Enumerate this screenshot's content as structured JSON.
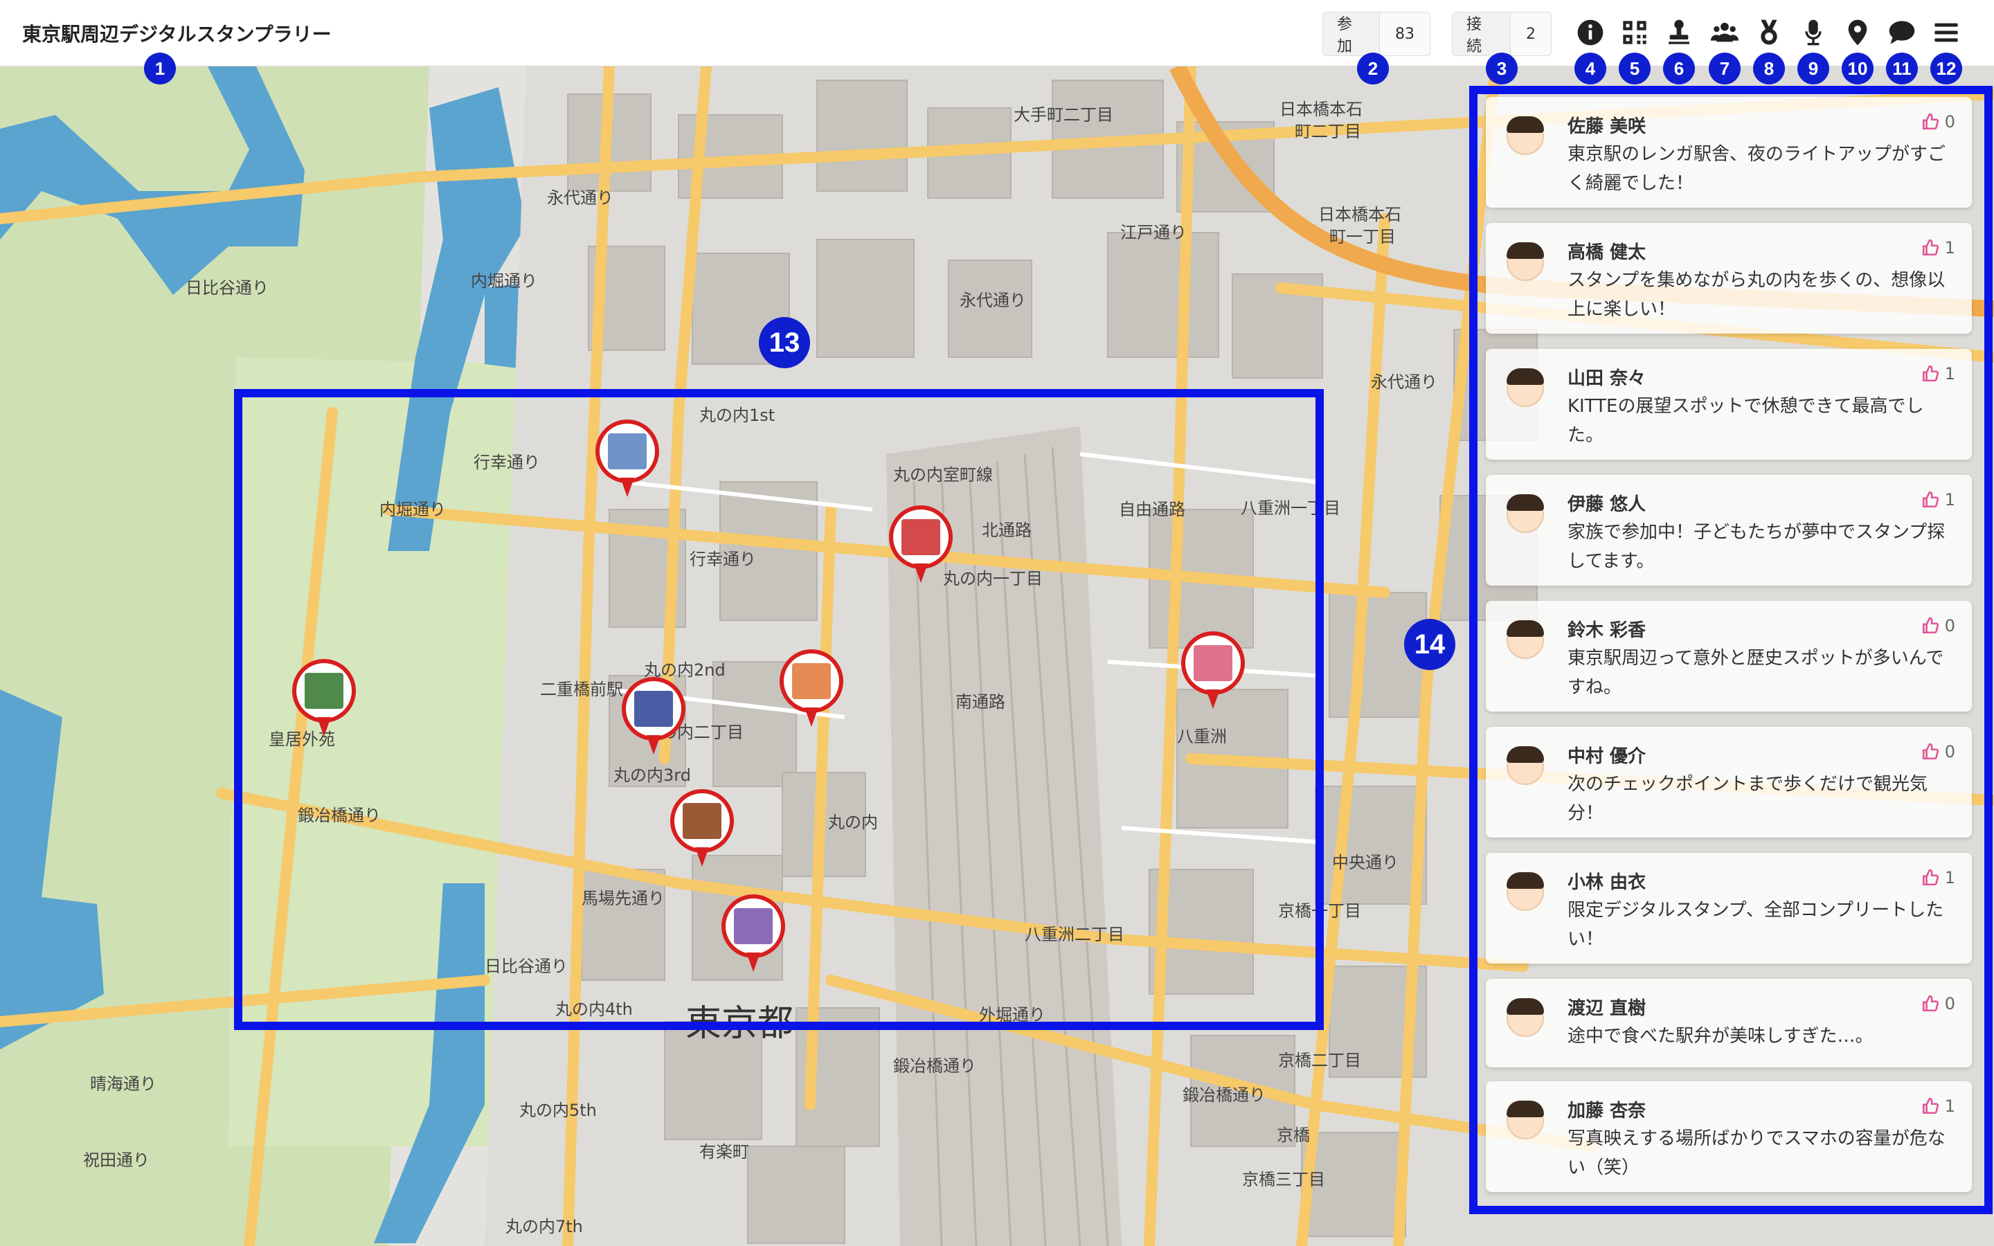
{
  "app": {
    "title": "東京駅周辺デジタルスタンプラリー"
  },
  "stats": {
    "join": {
      "label": "参加",
      "value": "83"
    },
    "connect": {
      "label": "接続",
      "value": "2"
    }
  },
  "toolbar": {
    "icons": [
      "info-icon",
      "qr-code-icon",
      "stamp-icon",
      "users-icon",
      "medal-icon",
      "microphone-icon",
      "map-pin-icon",
      "chat-bubble-icon",
      "menu-icon"
    ]
  },
  "annotations": [
    "1",
    "2",
    "3",
    "4",
    "5",
    "6",
    "7",
    "8",
    "9",
    "10",
    "11",
    "12",
    "13",
    "14"
  ],
  "map": {
    "labels": {
      "l1": "大手町二丁目",
      "l2": "日本橋本石",
      "l3": "町二丁目",
      "l4": "日本橋本石",
      "l5": "町一丁目",
      "l6": "永代通り",
      "l7": "永代通り",
      "l8": "内堀通り",
      "l9": "丸の内1st",
      "l10": "行幸通り",
      "l11": "行幸通り",
      "l12": "内堀通り",
      "l13": "丸の内室町線",
      "l14": "北通路",
      "l15": "丸の内一丁目",
      "l16": "八重洲一丁目",
      "l17": "南通路",
      "l18": "八重洲",
      "l19": "丸の内2nd",
      "l20": "丸の内二丁目",
      "l21": "皇居外苑",
      "l22": "丸の内3rd",
      "l23": "鍛冶橋通り",
      "l24": "丸の内",
      "l25": "馬場先通り",
      "l26": "日比谷通り",
      "l27": "八重洲二丁目",
      "l28": "京橋一丁目",
      "l29": "東京都",
      "l30": "丸の内4th",
      "l31": "京橋二丁目",
      "l32": "晴海通り",
      "l33": "丸の内5th",
      "l34": "有楽町",
      "l35": "京橋三丁目",
      "l36": "丸の内7th",
      "l37": "永代通り",
      "l38": "日比谷通り",
      "l39": "自由通路",
      "l40": "江戸通り",
      "l41": "鍛冶橋通り",
      "l42": "外堀通り",
      "l43": "中央通り",
      "l44": "京橋",
      "l45": "二重橋前駅",
      "l46": "鍛冶橋通り",
      "l47": "祝田通り"
    }
  },
  "comments": [
    {
      "name": "佐藤 美咲",
      "text": "東京駅のレンガ駅舎、夜のライトアップがすごく綺麗でした！",
      "likes": "0"
    },
    {
      "name": "高橋 健太",
      "text": "スタンプを集めながら丸の内を歩くの、想像以上に楽しい！",
      "likes": "1"
    },
    {
      "name": "山田 奈々",
      "text": "KITTEの展望スポットで休憩できて最高でした。",
      "likes": "1"
    },
    {
      "name": "伊藤 悠人",
      "text": "家族で参加中！子どもたちが夢中でスタンプ探してます。",
      "likes": "1"
    },
    {
      "name": "鈴木 彩香",
      "text": "東京駅周辺って意外と歴史スポットが多いんですね。",
      "likes": "0"
    },
    {
      "name": "中村 優介",
      "text": "次のチェックポイントまで歩くだけで観光気分！",
      "likes": "0"
    },
    {
      "name": "小林 由衣",
      "text": "限定デジタルスタンプ、全部コンプリートしたい！",
      "likes": "1"
    },
    {
      "name": "渡辺 直樹",
      "text": "途中で食べた駅弁が美味しすぎた…。",
      "likes": "0"
    },
    {
      "name": "加藤 杏奈",
      "text": "写真映えする場所ばかりでスマホの容量が危ない（笑）",
      "likes": "1"
    }
  ],
  "colors": {
    "highlight": "#0a14e8",
    "badge": "#0f1fd0",
    "pin": "#d81e1e",
    "like": "#e0559a"
  }
}
